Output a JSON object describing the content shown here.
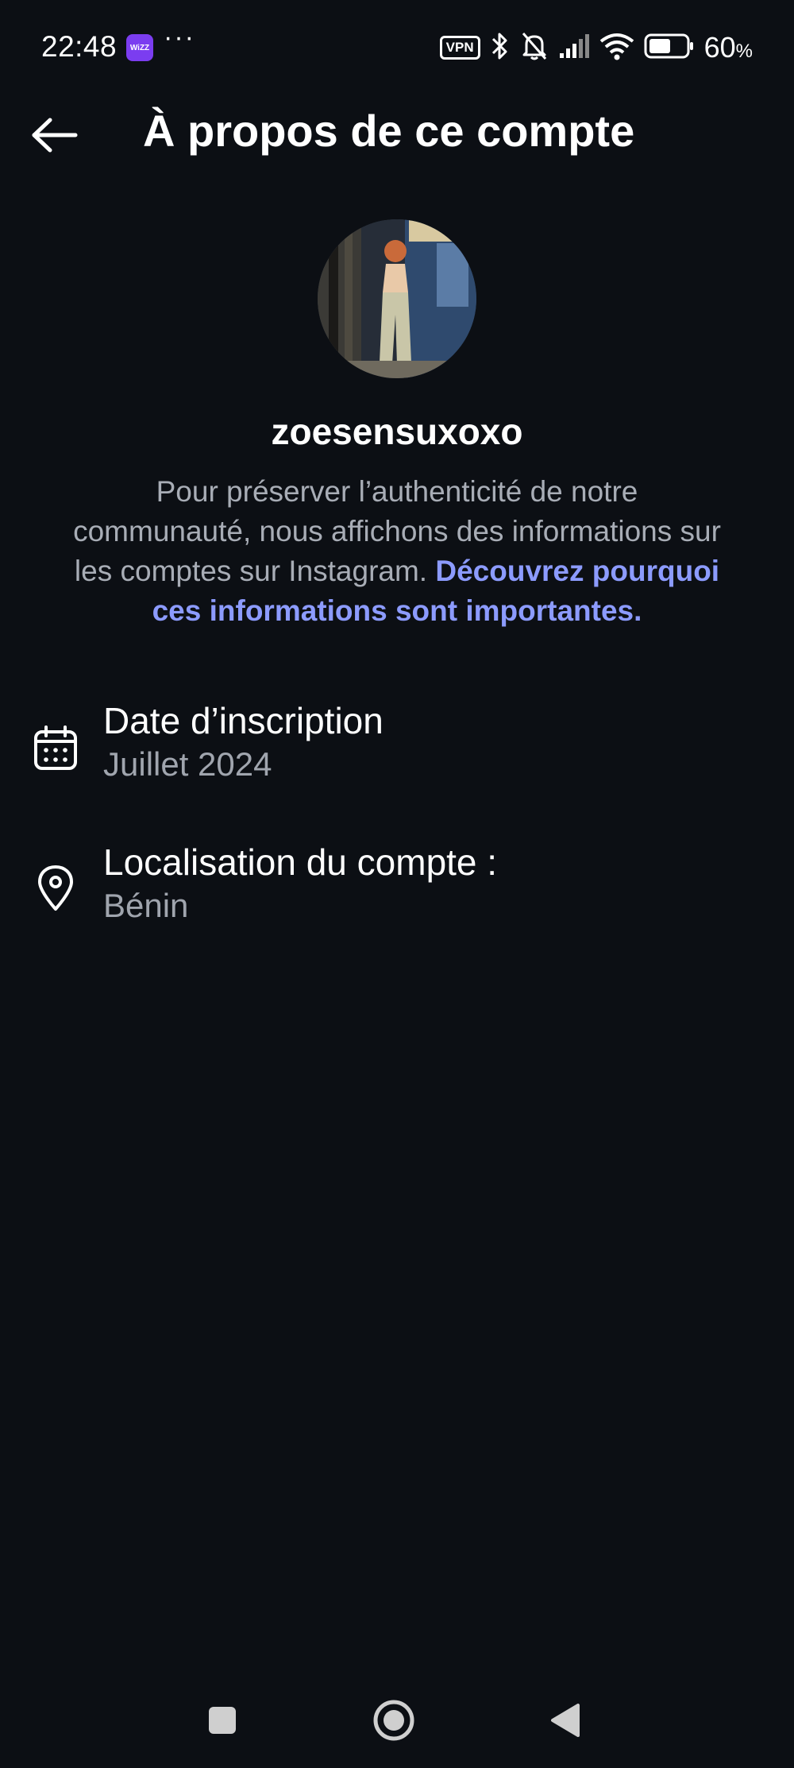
{
  "status_bar": {
    "time": "22:48",
    "app_badge": "WiZZ",
    "more": "···",
    "vpn": "VPN",
    "battery_percent": "60",
    "battery_unit": "%",
    "battery_level": 0.6
  },
  "header": {
    "title": "À propos de ce compte"
  },
  "profile": {
    "username": "zoesensuxoxo",
    "description_text": "Pour préserver l’authenticité de notre communauté, nous affichons des informations sur les comptes sur Instagram. ",
    "description_link": "Découvrez pourquoi ces informations sont importantes."
  },
  "info": {
    "join_date_label": "Date d’inscription",
    "join_date_value": "Juillet 2024",
    "location_label": "Localisation du compte :",
    "location_value": "Bénin"
  },
  "colors": {
    "background": "#0c0f14",
    "link": "#8c9bff",
    "secondary_text": "#a8adb6"
  }
}
